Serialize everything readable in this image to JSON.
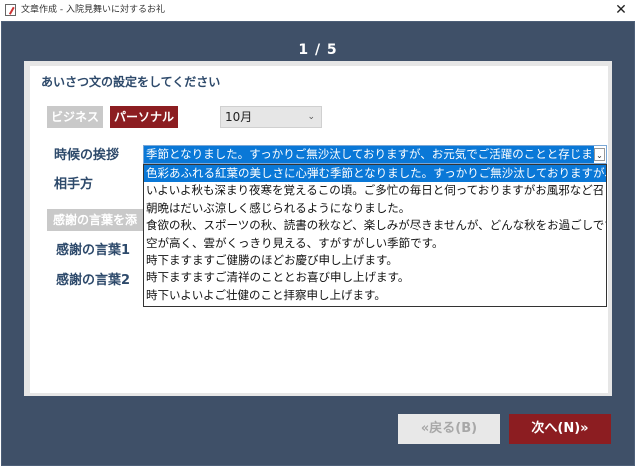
{
  "window": {
    "title": "文章作成 - 入院見舞いに対するお礼",
    "close_glyph": "✕"
  },
  "step": "1 / 5",
  "heading": "あいさつ文の設定をしてください",
  "tabs": {
    "business": "ビジネス",
    "personal": "パーソナル",
    "active": "personal"
  },
  "month_select": {
    "value": "10月",
    "chevron": "⌄"
  },
  "labels": {
    "season_greeting": "時候の挨拶",
    "recipient": "相手方",
    "add_thanks": "感謝の言葉を添",
    "thanks1": "感謝の言葉1",
    "thanks2": "感謝の言葉2"
  },
  "season_combo": {
    "value": "季節となりました。すっかりご無沙汰しておりますが、お元気でご活躍のことと存じます。",
    "arrow": "⌄",
    "options": [
      "色彩あふれる紅葉の美しさに心弾む季節となりました。すっかりご無沙汰しておりますが、",
      "いよいよ秋も深まり夜寒を覚えるこの頃。ご多忙の毎日と伺っておりますがお風邪など召",
      "朝晩はだいぶ涼しく感じられるようになりました。",
      "食欲の秋、スポーツの秋、読書の秋など、楽しみが尽きませんが、どんな秋をお過ごしです",
      "空が高く、雲がくっきり見える、すがすがしい季節です。",
      "時下ますますご健勝のほどお慶び申し上げます。",
      "時下ますますご清祥のこととお喜び申し上げます。",
      "時下いよいよご壮健のこと拝察申し上げます。"
    ],
    "selected_index": 0
  },
  "buttons": {
    "back": "«戻る(B)",
    "next": "次へ(N)»"
  },
  "colors": {
    "frame": "#3f5068",
    "accent": "#8c1d21",
    "heading": "#2e4a6b",
    "selection": "#0a78d7"
  }
}
